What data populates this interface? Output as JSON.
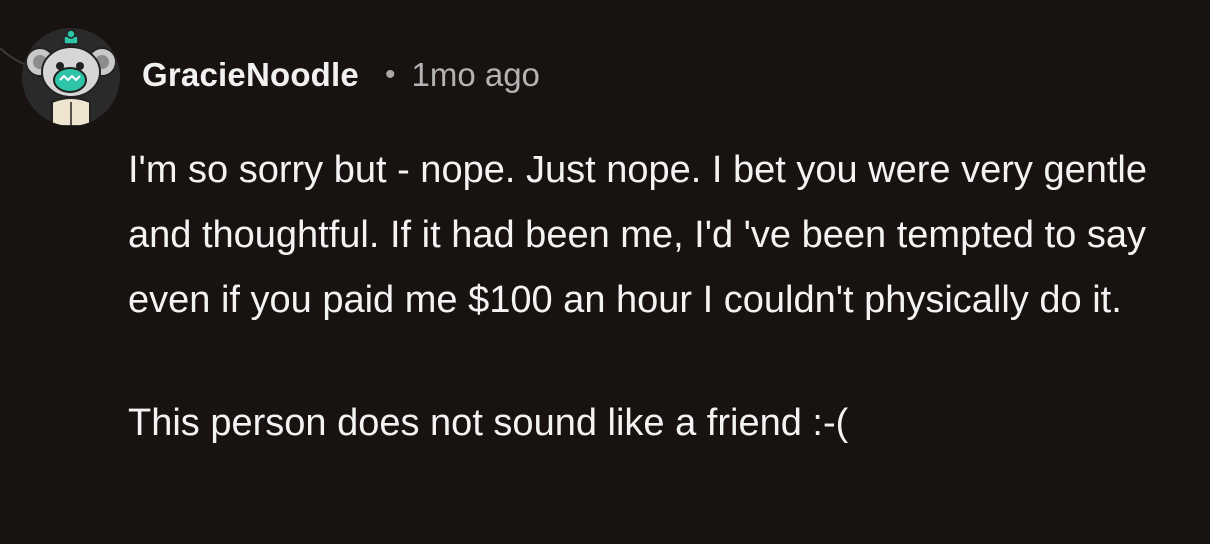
{
  "comment": {
    "author": "GracieNoodle",
    "separator": "•",
    "timestamp": "1mo ago",
    "paragraphs": [
      "I'm so sorry but - nope. Just nope. I bet you were very gentle and thoughtful. If it had been me, I'd 've been tempted to say even if you paid me $100 an hour I couldn't physically do it.",
      "This person does not sound like a friend :-("
    ]
  },
  "icons": {
    "avatar": "koala-avatar-icon",
    "thread": "thread-line-icon"
  },
  "colors": {
    "background": "#181311",
    "text": "#f3f3f3",
    "muted": "#b3b3b3",
    "avatar_accent": "#2ec4a7"
  }
}
